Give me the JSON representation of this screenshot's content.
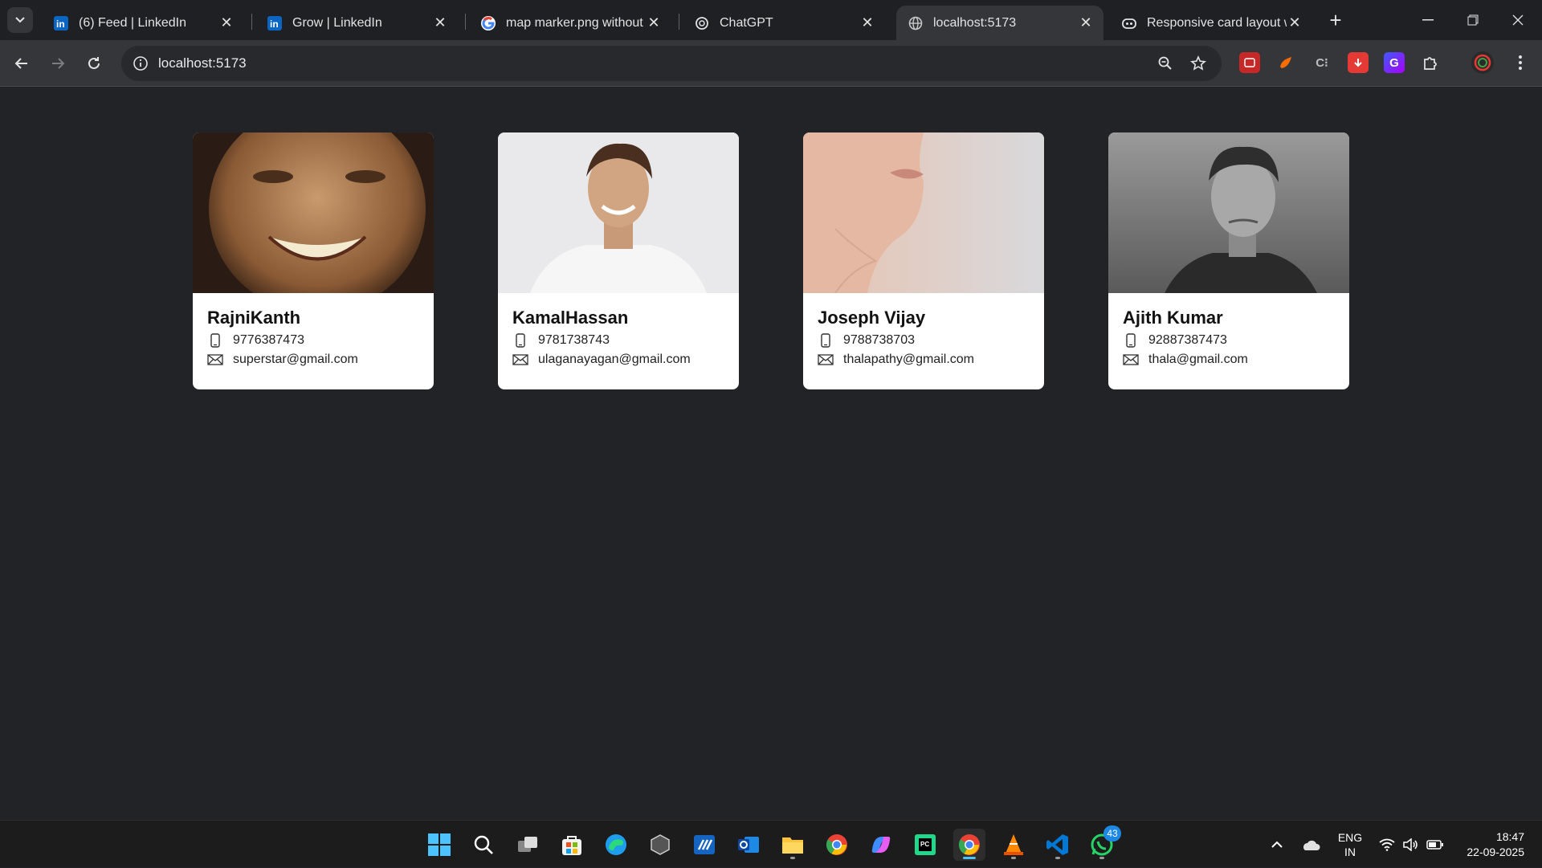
{
  "browser": {
    "tabs": [
      {
        "title": "(6) Feed | LinkedIn",
        "icon": "linkedin-icon",
        "active": false
      },
      {
        "title": "Grow | LinkedIn",
        "icon": "linkedin-icon",
        "active": false
      },
      {
        "title": "map marker.png without b",
        "icon": "google-icon",
        "active": false
      },
      {
        "title": "ChatGPT",
        "icon": "chatgpt-icon",
        "active": false
      },
      {
        "title": "localhost:5173",
        "icon": "globe-icon",
        "active": true
      },
      {
        "title": "Responsive card layout wi",
        "icon": "copilot-icon",
        "active": false
      }
    ],
    "close_glyph": "✕",
    "new_tab_glyph": "+",
    "address": "localhost:5173"
  },
  "cards": [
    {
      "name": "RajniKanth",
      "phone": "9776387473",
      "email": "superstar@gmail.com"
    },
    {
      "name": "KamalHassan",
      "phone": "9781738743",
      "email": "ulaganayagan@gmail.com"
    },
    {
      "name": "Joseph Vijay",
      "phone": "9788738703",
      "email": "thalapathy@gmail.com"
    },
    {
      "name": "Ajith Kumar",
      "phone": "92887387473",
      "email": "thala@gmail.com"
    }
  ],
  "taskbar": {
    "whatsapp_badge": "43",
    "language": "ENG",
    "region": "IN",
    "time": "18:47",
    "date": "22-09-2025"
  },
  "colors": {
    "page_bg": "#222327",
    "card_bg": "#ffffff",
    "accent": "#4cc2ff"
  }
}
